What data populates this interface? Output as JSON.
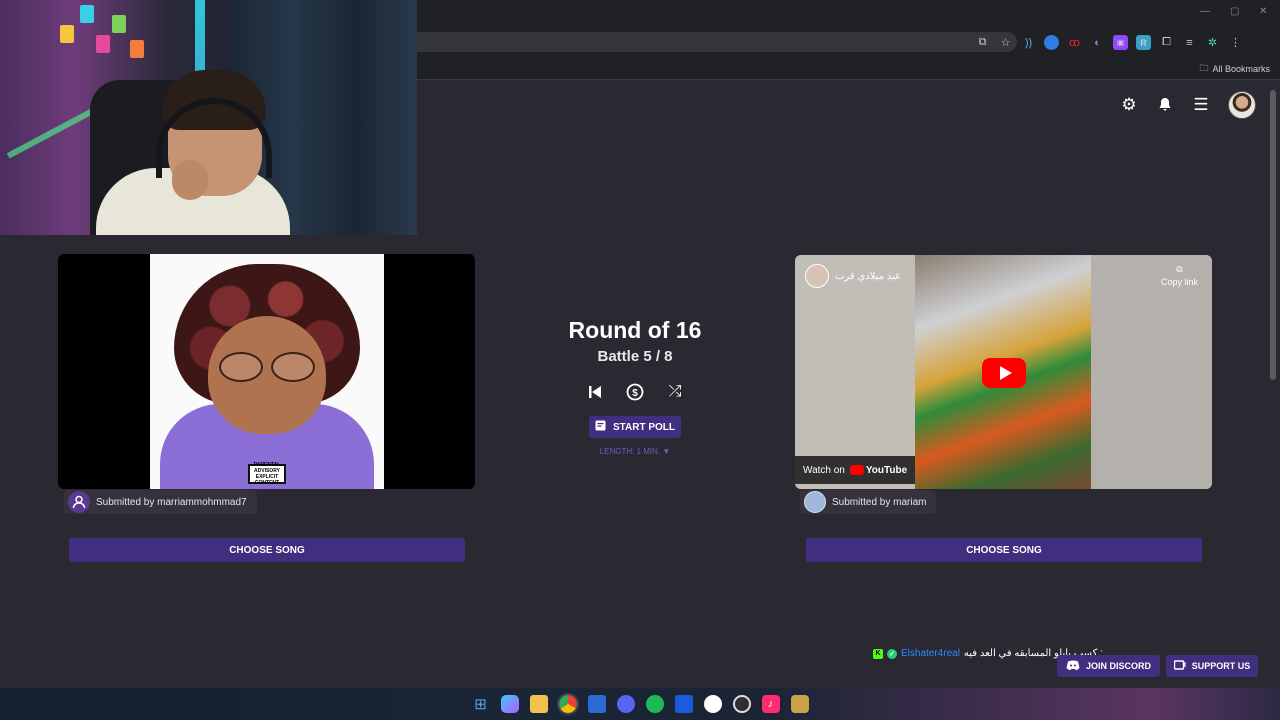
{
  "browser": {
    "bookmarks_label": "All Bookmarks",
    "extensions": [
      "cast-icon",
      "star-icon",
      "ext-audio-icon",
      "ext-blue-icon",
      "ext-red-icon",
      "ext-purple-icon",
      "ext-twitch-icon",
      "ext-r-icon",
      "puzzle-icon",
      "media-icon",
      "ext-gear-icon",
      "menu-dots-icon"
    ]
  },
  "header": {
    "icons": [
      "gear-icon",
      "bell-icon",
      "menu-icon"
    ]
  },
  "battle": {
    "round_title": "Round of 16",
    "battle_label": "Battle 5 / 8",
    "start_poll_label": "START POLL",
    "length_label": "LENGTH: 1 MIN. ▼"
  },
  "left": {
    "submitted_by": "Submitted by marriammohmmad7",
    "choose_label": "CHOOSE SONG",
    "parental_advisory": "PARENTAL ADVISORY EXPLICIT CONTENT"
  },
  "right": {
    "channel_title": "عيد ميلادي قرب",
    "copy_link_label": "Copy link",
    "watch_on_label": "Watch on",
    "youtube_label": "YouTube",
    "submitted_by": "Submitted by mariam",
    "choose_label": "CHOOSE SONG"
  },
  "chat": {
    "user": "Elshater4real",
    "message": ": كسب بابلو المسابقه في العد فيه"
  },
  "footer": {
    "discord_label": "JOIN DISCORD",
    "support_label": "SUPPORT US"
  },
  "colors": {
    "background": "#2a2831",
    "accent": "#3f2f7e",
    "length_text": "#6d5fc1",
    "chat_user": "#2c8bff"
  }
}
